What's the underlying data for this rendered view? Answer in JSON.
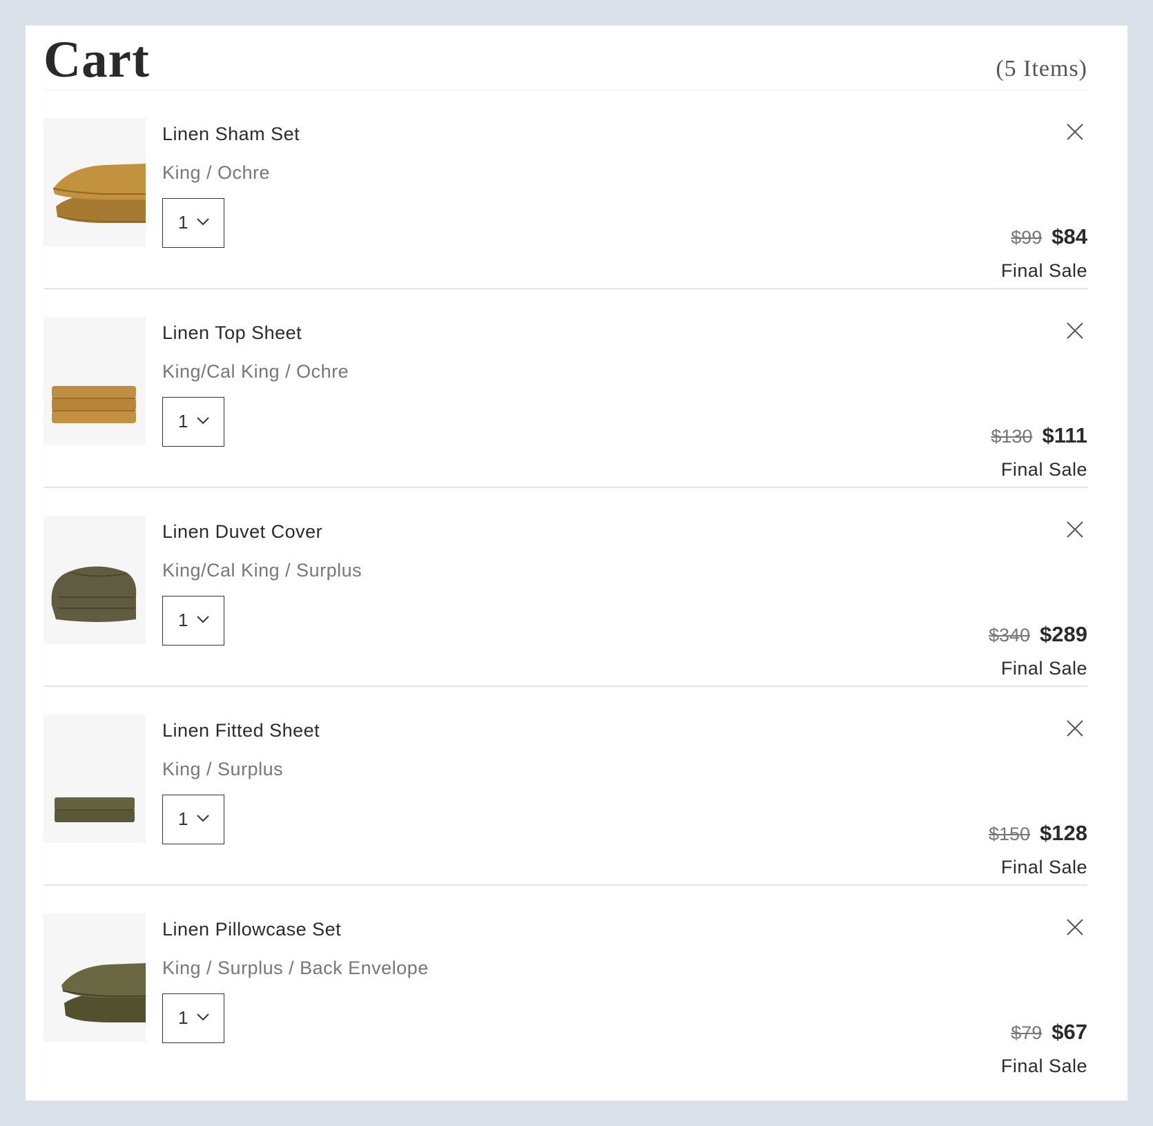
{
  "cart": {
    "title": "Cart",
    "item_count": "(5 Items)"
  },
  "colors": {
    "background": "#dae1e8",
    "panel": "#ffffff",
    "ochre": "#b98a3c",
    "surplus": "#5e5e3f"
  },
  "items": [
    {
      "name": "Linen Sham Set",
      "variant": "King / Ochre",
      "quantity": "1",
      "original_price": "$99",
      "sale_price": "$84",
      "note": "Final Sale",
      "image": "ochre-sham-pillows"
    },
    {
      "name": "Linen Top Sheet",
      "variant": "King/Cal King / Ochre",
      "quantity": "1",
      "original_price": "$130",
      "sale_price": "$111",
      "note": "Final Sale",
      "image": "ochre-folded-sheet"
    },
    {
      "name": "Linen Duvet Cover",
      "variant": "King/Cal King / Surplus",
      "quantity": "1",
      "original_price": "$340",
      "sale_price": "$289",
      "note": "Final Sale",
      "image": "surplus-folded-duvet"
    },
    {
      "name": "Linen Fitted Sheet",
      "variant": "King / Surplus",
      "quantity": "1",
      "original_price": "$150",
      "sale_price": "$128",
      "note": "Final Sale",
      "image": "surplus-folded-sheet"
    },
    {
      "name": "Linen Pillowcase Set",
      "variant": "King / Surplus / Back Envelope",
      "quantity": "1",
      "original_price": "$79",
      "sale_price": "$67",
      "note": "Final Sale",
      "image": "surplus-pillows"
    }
  ]
}
